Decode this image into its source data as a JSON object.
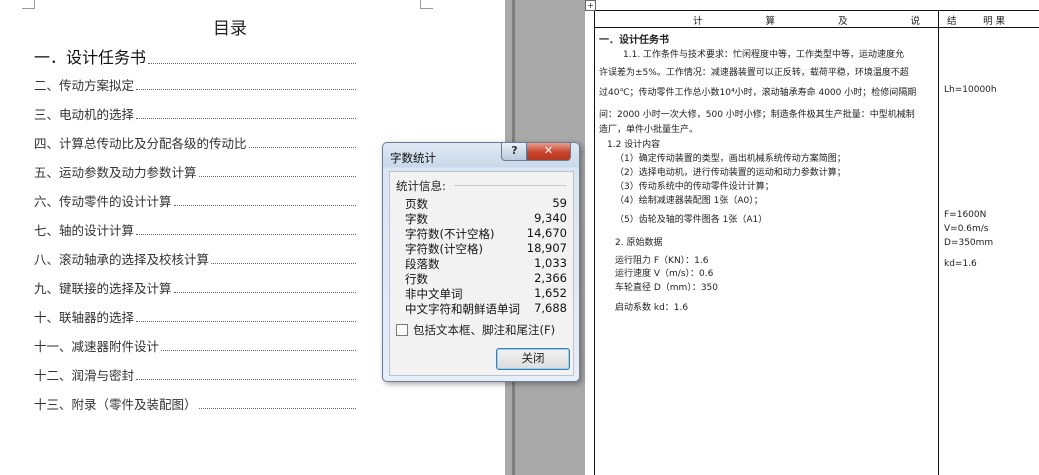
{
  "left_page": {
    "toc_title": "目录",
    "toc": [
      {
        "label": "一．设计任务书"
      },
      {
        "label": "二、传动方案拟定"
      },
      {
        "label": "三、电动机的选择"
      },
      {
        "label": "四、计算总传动比及分配各级的传动比"
      },
      {
        "label": "五、运动参数及动力参数计算"
      },
      {
        "label": "六、传动零件的设计计算"
      },
      {
        "label": "七、轴的设计计算"
      },
      {
        "label": "八、滚动轴承的选择及校核计算"
      },
      {
        "label": "九、键联接的选择及计算"
      },
      {
        "label": "十、联轴器的选择"
      },
      {
        "label": "十一、减速器附件设计"
      },
      {
        "label": "十二、润滑与密封"
      },
      {
        "label": "十三、附录（零件及装配图）"
      }
    ]
  },
  "dialog": {
    "title": "字数统计",
    "help_label": "?",
    "close_x": "✕",
    "stats_label": "统计信息:",
    "stats": [
      {
        "label": "页数",
        "value": "59"
      },
      {
        "label": "字数",
        "value": "9,340"
      },
      {
        "label": "字符数(不计空格)",
        "value": "14,670"
      },
      {
        "label": "字符数(计空格)",
        "value": "18,907"
      },
      {
        "label": "段落数",
        "value": "1,033"
      },
      {
        "label": "行数",
        "value": "2,366"
      },
      {
        "label": "非中文单词",
        "value": "1,652"
      },
      {
        "label": "中文字符和朝鲜语单词",
        "value": "7,688"
      }
    ],
    "include_label": "包括文本框、脚注和尾注(F)",
    "include_checked": false,
    "close_button": "关闭"
  },
  "right_page": {
    "move_handle": "+",
    "header_calc": "计 算 及 说 明",
    "header_result": "结 果",
    "section_title": "一．设计任务书",
    "lines": [
      "1.1. 工作条件与技术要求：忙闲程度中等，工作类型中等，运动速度允",
      "许误差为±5%。工作情况：减速器装置可以正反转，载荷平稳，环境温度不超",
      "过40℃；传动零件工作总小数10⁴小时，滚动轴承寿命 4000 小时；检修间隔期",
      "间：2000 小时一次大修，500 小时小修；制造条件极其生产批量：中型机械制",
      "造厂，单件小批量生产。",
      "1.2 设计内容",
      "（1）确定传动装置的类型，画出机械系统传动方案简图；",
      "（2）选择电动机，进行传动装置的运动和动力参数计算；",
      "（3）传动系统中的传动零件设计计算；",
      "（4）绘制减速器装配图 1张（A0）；",
      "（5）齿轮及轴的零件图各 1张（A1）",
      "2. 原始数据",
      "运行阻力 F（KN）：1.6",
      "运行速度 V（m/s）：0.6",
      "车轮直径 D（mm）：350",
      "启动系数 kd：1.6"
    ],
    "results": [
      "Lh=10000h",
      "F=1600N",
      "V=0.6m/s",
      "D=350mm",
      "kd=1.6"
    ]
  }
}
